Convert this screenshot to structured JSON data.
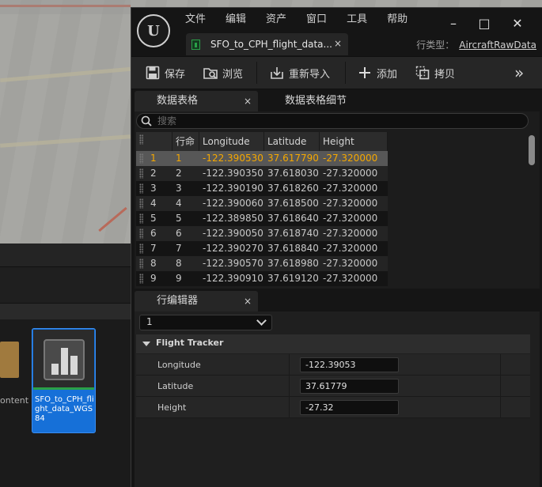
{
  "viewport": {
    "label": ""
  },
  "content_browser": {
    "folder_label": "ontent",
    "asset": {
      "label": "SFO_to_CPH_flight_data_WGS84"
    }
  },
  "editor": {
    "menu": [
      "文件",
      "编辑",
      "资产",
      "窗口",
      "工具",
      "帮助"
    ],
    "document_tab": {
      "label": "SFO_to_CPH_flight_data...",
      "close": "×"
    },
    "parent_class": {
      "label": "行类型：",
      "value": "AircraftRawData"
    },
    "window_controls": {
      "minimize": "–",
      "maximize": "□",
      "close": "✕"
    },
    "toolbar": {
      "save": "保存",
      "browse": "浏览",
      "reimport": "重新导入",
      "add": "添加",
      "copy": "拷贝",
      "more": "»"
    },
    "data_table": {
      "tab_label": "数据表格",
      "tab_close": "×",
      "details_tab_label": "数据表格细节",
      "search_placeholder": "搜索",
      "columns": [
        "",
        "行命",
        "Longitude",
        "Latitude",
        "Height"
      ],
      "selected_row": 0,
      "rows": [
        {
          "index": "1",
          "name": "1",
          "lon": "-122.390530",
          "lat": "37.617790",
          "h": "-27.320000"
        },
        {
          "index": "2",
          "name": "2",
          "lon": "-122.390350",
          "lat": "37.618030",
          "h": "-27.320000"
        },
        {
          "index": "3",
          "name": "3",
          "lon": "-122.390190",
          "lat": "37.618260",
          "h": "-27.320000"
        },
        {
          "index": "4",
          "name": "4",
          "lon": "-122.390060",
          "lat": "37.618500",
          "h": "-27.320000"
        },
        {
          "index": "5",
          "name": "5",
          "lon": "-122.389850",
          "lat": "37.618640",
          "h": "-27.320000"
        },
        {
          "index": "6",
          "name": "6",
          "lon": "-122.390050",
          "lat": "37.618740",
          "h": "-27.320000"
        },
        {
          "index": "7",
          "name": "7",
          "lon": "-122.390270",
          "lat": "37.618840",
          "h": "-27.320000"
        },
        {
          "index": "8",
          "name": "8",
          "lon": "-122.390570",
          "lat": "37.618980",
          "h": "-27.320000"
        },
        {
          "index": "9",
          "name": "9",
          "lon": "-122.390910",
          "lat": "37.619120",
          "h": "-27.320000"
        }
      ]
    },
    "row_editor": {
      "tab_label": "行编辑器",
      "tab_close": "×",
      "selected_row_name": "1",
      "category": "Flight Tracker",
      "props": [
        {
          "name": "Longitude",
          "value": "-122.39053"
        },
        {
          "name": "Latitude",
          "value": "37.61779"
        },
        {
          "name": "Height",
          "value": "-27.32"
        }
      ]
    },
    "colors": {
      "selected_text": "#f5a800",
      "accent_green": "#2aa048",
      "asset_blue": "#1670d8"
    }
  }
}
